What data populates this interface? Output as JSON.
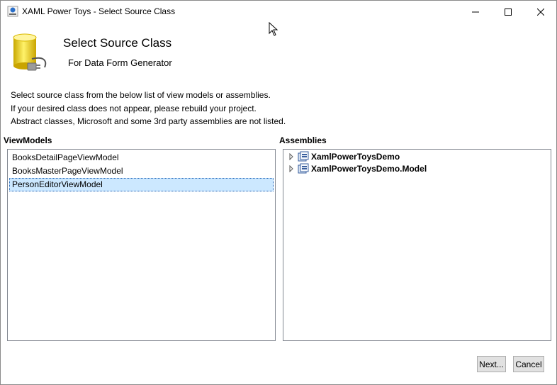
{
  "window": {
    "title": "XAML Power Toys - Select Source Class",
    "controls": {
      "minimize": "minimize-icon",
      "maximize": "maximize-icon",
      "close": "close-icon"
    }
  },
  "header": {
    "title": "Select Source Class",
    "subtitle": "For Data Form Generator",
    "icon": "database-plug-icon"
  },
  "instructions": [
    "Select source class from the below list of view models or assemblies.",
    "If your desired class does not appear, please rebuild your project.",
    "Abstract classes, Microsoft and some 3rd party assemblies are not listed."
  ],
  "viewmodels": {
    "label": "ViewModels",
    "items": [
      {
        "label": "BooksDetailPageViewModel",
        "selected": false
      },
      {
        "label": "BooksMasterPageViewModel",
        "selected": false
      },
      {
        "label": "PersonEditorViewModel",
        "selected": true
      }
    ]
  },
  "assemblies": {
    "label": "Assemblies",
    "items": [
      {
        "label": "XamlPowerToysDemo",
        "expanded": false
      },
      {
        "label": "XamlPowerToysDemo.Model",
        "expanded": false
      }
    ]
  },
  "buttons": {
    "next": "Next...",
    "cancel": "Cancel"
  },
  "colors": {
    "selection": "#cce8ff",
    "selection_border": "#1a5fb4",
    "button_bg": "#e1e1e1"
  }
}
